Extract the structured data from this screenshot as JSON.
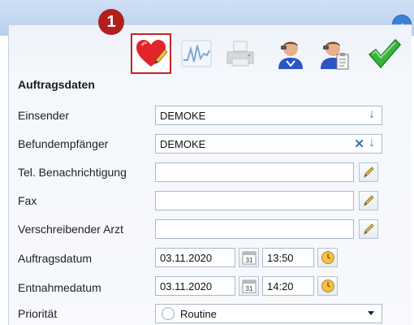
{
  "badge": "1",
  "section_title": "Auftragsdaten",
  "toolbar": [
    "heart-pen-icon",
    "chart-wave-icon",
    "printer-icon",
    "doctor-icon",
    "doctor-clipboard-icon",
    "checkmark-icon"
  ],
  "fields": {
    "einsender": {
      "label": "Einsender",
      "value": "DEMOKE"
    },
    "befundempfaenger": {
      "label": "Befundempfänger",
      "value": "DEMOKE"
    },
    "tel": {
      "label": "Tel. Benachrichtigung",
      "value": ""
    },
    "fax": {
      "label": "Fax",
      "value": ""
    },
    "arzt": {
      "label": "Verschreibender Arzt",
      "value": ""
    },
    "auftragsdatum": {
      "label": "Auftragsdatum",
      "date": "03.11.2020",
      "time": "13:50"
    },
    "entnahmedatum": {
      "label": "Entnahmedatum",
      "date": "03.11.2020",
      "time": "14:20"
    },
    "prioritaet": {
      "label": "Priorität",
      "value": "Routine"
    }
  },
  "calendar_day": "31",
  "colors": {
    "accent": "#3d7fd6",
    "badge": "#b2201c",
    "highlight": "#c4242a"
  }
}
